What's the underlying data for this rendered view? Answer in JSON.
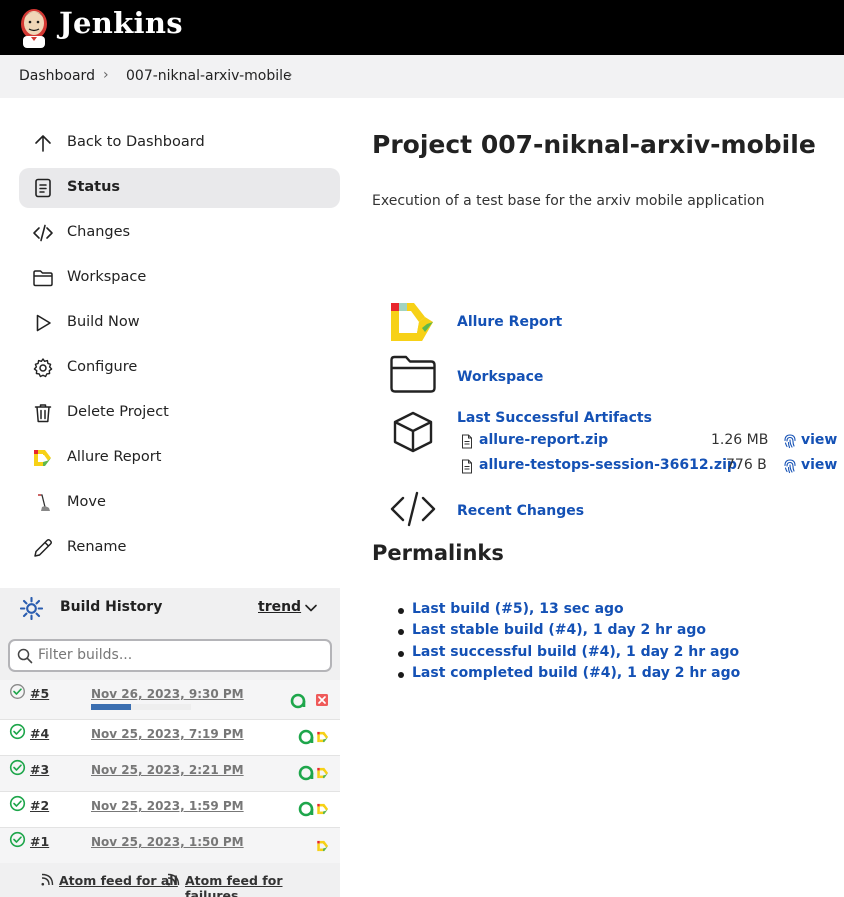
{
  "header": {
    "title": "Jenkins"
  },
  "breadcrumb": {
    "items": [
      "Dashboard",
      "007-niknal-arxiv-mobile"
    ]
  },
  "sidebar": {
    "tasks": [
      {
        "label": "Back to Dashboard",
        "icon": "arrow-up-icon"
      },
      {
        "label": "Status",
        "icon": "document-icon",
        "active": true
      },
      {
        "label": "Changes",
        "icon": "code-icon"
      },
      {
        "label": "Workspace",
        "icon": "folder-icon"
      },
      {
        "label": "Build Now",
        "icon": "play-icon"
      },
      {
        "label": "Configure",
        "icon": "gear-icon"
      },
      {
        "label": "Delete Project",
        "icon": "trash-icon"
      },
      {
        "label": "Allure Report",
        "icon": "allure-icon"
      },
      {
        "label": "Move",
        "icon": "move-icon"
      },
      {
        "label": "Rename",
        "icon": "pencil-icon"
      }
    ]
  },
  "build_history": {
    "title": "Build History",
    "trend_label": "trend",
    "filter_placeholder": "Filter builds...",
    "builds": [
      {
        "num": "#5",
        "date": "Nov 26, 2023, 9:30 PM",
        "in_progress": true,
        "progress": 0.4,
        "badges": [
          "allure-testops-icon",
          "abort-icon"
        ]
      },
      {
        "num": "#4",
        "date": "Nov 25, 2023, 7:19 PM",
        "badges": [
          "allure-testops-icon",
          "allure-icon"
        ]
      },
      {
        "num": "#3",
        "date": "Nov 25, 2023, 2:21 PM",
        "badges": [
          "allure-testops-icon",
          "allure-icon"
        ]
      },
      {
        "num": "#2",
        "date": "Nov 25, 2023, 1:59 PM",
        "badges": [
          "allure-testops-icon",
          "allure-icon"
        ]
      },
      {
        "num": "#1",
        "date": "Nov 25, 2023, 1:50 PM",
        "badges": [
          "allure-icon"
        ]
      }
    ],
    "feed_all": "Atom feed for all",
    "feed_failures": "Atom feed for failures"
  },
  "main": {
    "title": "Project 007-niknal-arxiv-mobile",
    "description": "Execution of a test base for the arxiv mobile application",
    "links": {
      "allure": "Allure Report",
      "workspace": "Workspace",
      "artifacts": "Last Successful Artifacts",
      "changes": "Recent Changes"
    },
    "artifacts": [
      {
        "name": "allure-report.zip",
        "size": "1.26 MB",
        "view": "view"
      },
      {
        "name": "allure-testops-session-36612.zip",
        "size": "776 B",
        "view": "view"
      }
    ],
    "permalinks_title": "Permalinks",
    "permalinks": [
      "Last build (#5), 13 sec ago",
      "Last stable build (#4), 1 day 2 hr ago",
      "Last successful build (#4), 1 day 2 hr ago",
      "Last completed build (#4), 1 day 2 hr ago"
    ]
  },
  "colors": {
    "link": "#1451b5",
    "success": "#1ea64b",
    "allure_yellow": "#f7d117",
    "allure_red": "#e8262d",
    "allure_green": "#5fb84d",
    "progress": "#3a6eb0"
  }
}
